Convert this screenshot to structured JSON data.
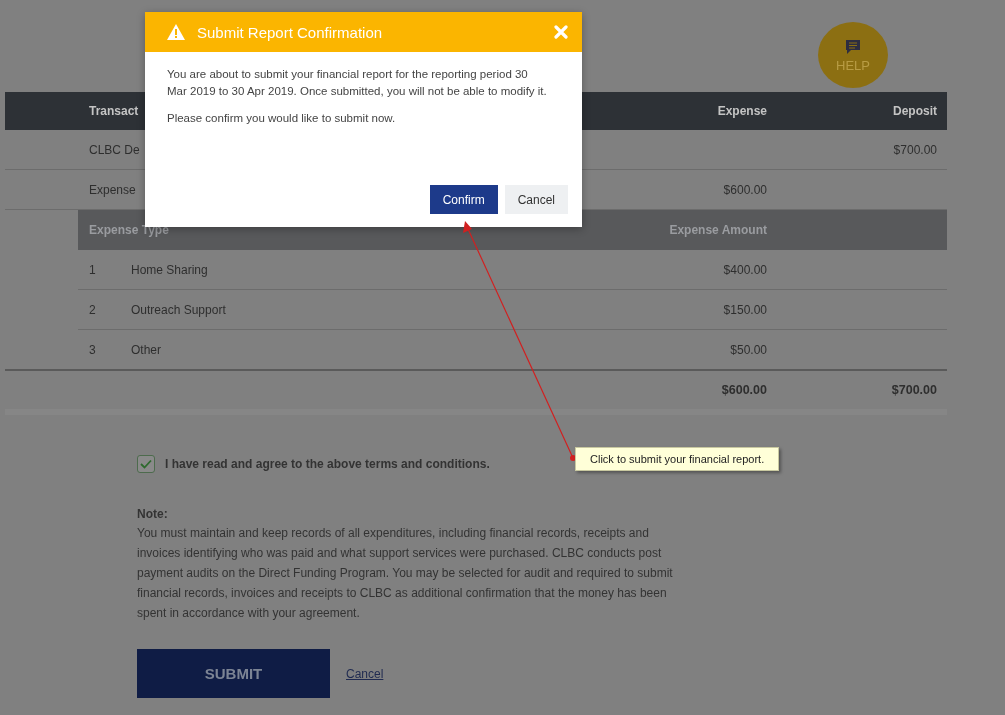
{
  "help_button": {
    "label": "HELP"
  },
  "transactions": {
    "columns": [
      "Transact",
      "Expense",
      "Deposit"
    ],
    "rows": [
      {
        "description": "CLBC De",
        "deposit": "$700.00"
      },
      {
        "description": "Expense",
        "expense": "$600.00"
      }
    ]
  },
  "expense_breakdown": {
    "columns": [
      "Expense Type",
      "Expense Amount"
    ],
    "rows": [
      {
        "number": "1",
        "type": "Home Sharing",
        "amount": "$400.00"
      },
      {
        "number": "2",
        "type": "Outreach Support",
        "amount": "$150.00"
      },
      {
        "number": "3",
        "type": "Other",
        "amount": "$50.00"
      }
    ]
  },
  "totals": {
    "expense": "$600.00",
    "deposit": "$700.00"
  },
  "agreement": {
    "label": "I have read and agree to the above terms and conditions.",
    "checked": true
  },
  "note": {
    "heading": "Note:",
    "text": "You must maintain and keep records of all expenditures, including financial records, receipts and invoices identifying who was paid and what support services were purchased. CLBC conducts post payment audits on the Direct Funding Program. You may be selected for audit and required to submit financial records, invoices and receipts to CLBC as additional confirmation that the money has been spent in accordance with your agreement."
  },
  "actions": {
    "submit": "SUBMIT",
    "cancel": "Cancel"
  },
  "dialog": {
    "title": "Submit Report Confirmation",
    "paragraphs": [
      "You are about to submit your financial report for the reporting period 30 Mar 2019 to 30 Apr 2019. Once submitted, you will not be able to modify it.",
      "Please confirm you would like to submit now."
    ],
    "buttons": [
      {
        "label": "Confirm",
        "kind": "primary"
      },
      {
        "label": "Cancel",
        "kind": "secondary"
      }
    ]
  },
  "callout": {
    "text": "Click to submit your financial report."
  }
}
